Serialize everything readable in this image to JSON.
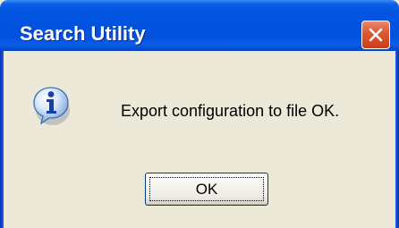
{
  "window": {
    "title": "Search Utility",
    "close_icon": "close-icon"
  },
  "dialog": {
    "icon": "information-icon",
    "message": "Export configuration to file OK.",
    "ok_label": "OK"
  },
  "colors": {
    "titlebar_blue": "#0153df",
    "close_red": "#dc5b36",
    "dialog_background": "#ece9d8",
    "button_border": "#003c74"
  }
}
